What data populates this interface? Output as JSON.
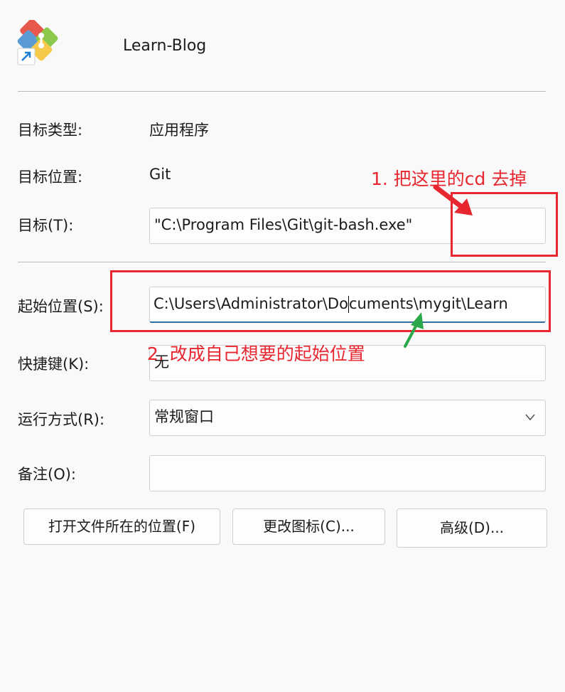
{
  "header": {
    "title": "Learn-Blog",
    "icon": "git-shortcut-icon"
  },
  "fields": {
    "target_type": {
      "label": "目标类型:",
      "value": "应用程序"
    },
    "target_location": {
      "label": "目标位置:",
      "value": "Git"
    },
    "target": {
      "label": "目标(T):",
      "value": "\"C:\\Program Files\\Git\\git-bash.exe\""
    },
    "start_in": {
      "label": "起始位置(S):",
      "value_before_caret": "C:\\Users\\Administrator\\Do",
      "value_after_caret": "cuments\\mygit\\Learn"
    },
    "shortcut_key": {
      "label": "快捷键(K):",
      "value": "无"
    },
    "run": {
      "label": "运行方式(R):",
      "value": "常规窗口"
    },
    "comment": {
      "label": "备注(O):",
      "value": ""
    }
  },
  "buttons": {
    "open_location": "打开文件所在的位置(F)",
    "change_icon": "更改图标(C)...",
    "advanced": "高级(D)..."
  },
  "annotations": {
    "note1": "1. 把这里的cd 去掉",
    "note2": "2. 改成自己想要的起始位置",
    "red": "#e8262f",
    "green": "#2aa84a"
  }
}
